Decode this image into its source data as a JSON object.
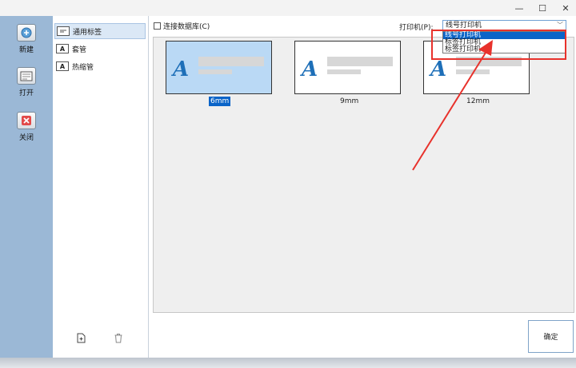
{
  "window": {
    "minimize_glyph": "—",
    "maximize_glyph": "☐",
    "close_glyph": "✕"
  },
  "toolbar": {
    "items": [
      {
        "label": "新建",
        "icon": "new-label-icon"
      },
      {
        "label": "打开",
        "icon": "open-folder-icon"
      },
      {
        "label": "关闭",
        "icon": "close-doc-icon"
      }
    ]
  },
  "categories": [
    {
      "label": "通用标签",
      "icon_text": "",
      "selected": true
    },
    {
      "label": "套管",
      "icon_text": "A",
      "selected": false
    },
    {
      "label": "热缩管",
      "icon_text": "A",
      "selected": false
    }
  ],
  "options": {
    "connect_db_label": "连接数据库(C)",
    "connect_db_checked": false
  },
  "printer": {
    "label": "打印机(P):",
    "selected": "线号打印机",
    "options": [
      "线号打印机",
      "标签打印机",
      "标签打印机"
    ]
  },
  "templates": [
    {
      "size": "6mm",
      "selected": true,
      "glyph": "A"
    },
    {
      "size": "9mm",
      "selected": false,
      "glyph": "A"
    },
    {
      "size": "12mm",
      "selected": false,
      "glyph": "A"
    }
  ],
  "ok_label": "确定",
  "colors": {
    "accent": "#0a64c8",
    "toolbar_bg": "#9bb8d6",
    "annotation": "#e8322c"
  }
}
